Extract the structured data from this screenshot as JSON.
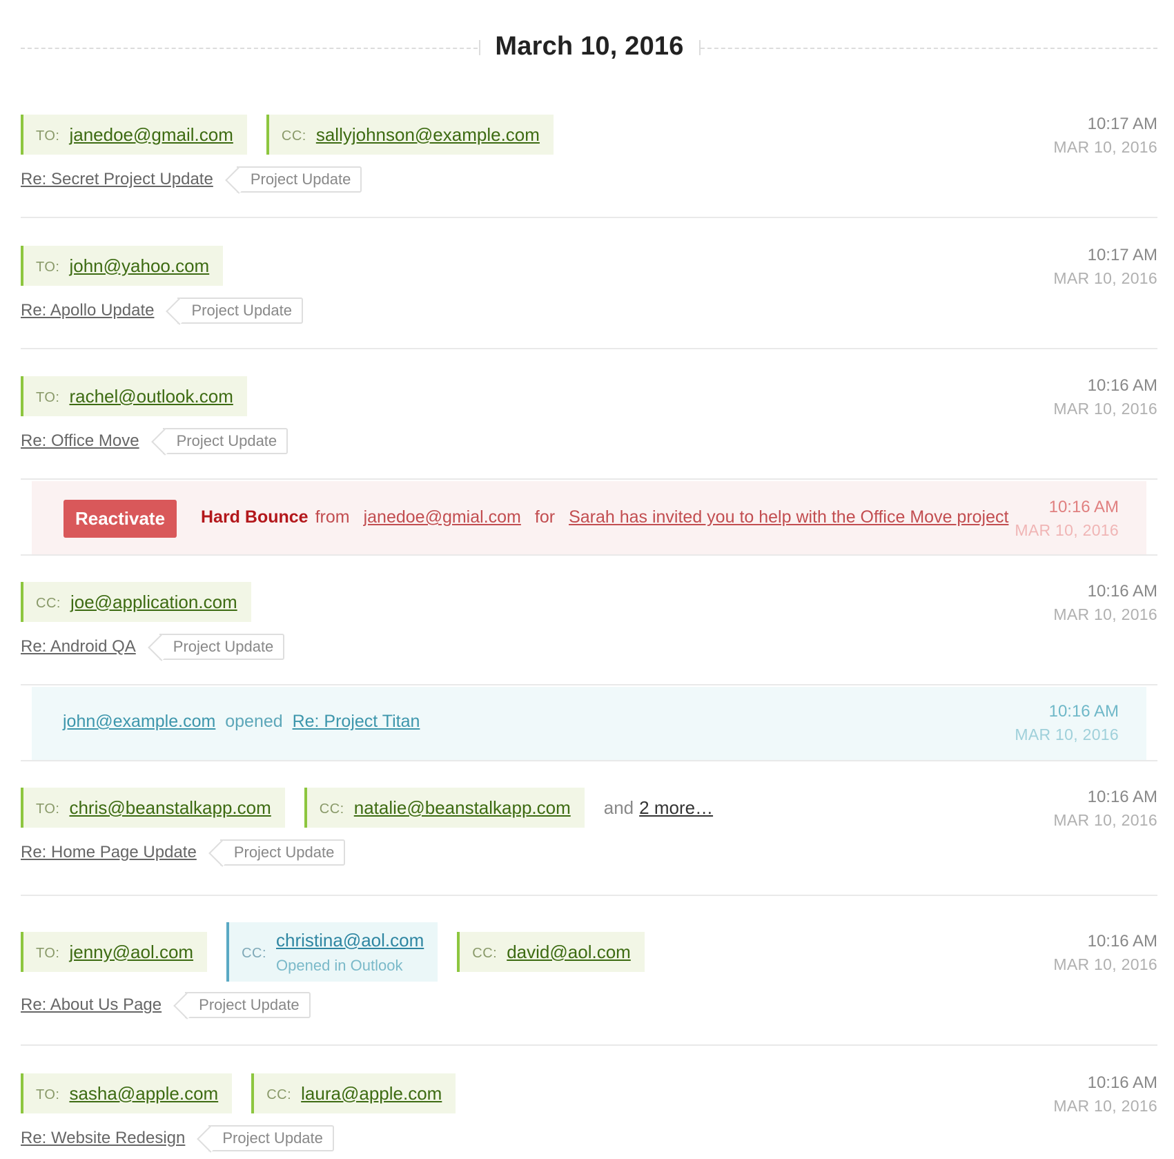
{
  "date_header": "March 10, 2016",
  "rows": [
    {
      "recipients": [
        {
          "label": "TO:",
          "address": "janedoe@gmail.com"
        },
        {
          "label": "CC:",
          "address": "sallyjohnson@example.com"
        }
      ],
      "subject": "Re: Secret Project Update",
      "tag": "Project Update",
      "time": "10:17 AM",
      "date": "MAR 10, 2016"
    },
    {
      "recipients": [
        {
          "label": "TO:",
          "address": "john@yahoo.com"
        }
      ],
      "subject": "Re: Apollo Update",
      "tag": "Project Update",
      "time": "10:17 AM",
      "date": "MAR 10, 2016"
    },
    {
      "recipients": [
        {
          "label": "TO:",
          "address": "rachel@outlook.com"
        }
      ],
      "subject": "Re: Office Move",
      "tag": "Project Update",
      "time": "10:16 AM",
      "date": "MAR 10, 2016"
    },
    {
      "recipients": [
        {
          "label": "CC:",
          "address": "joe@application.com"
        }
      ],
      "subject": "Re: Android QA",
      "tag": "Project Update",
      "time": "10:16 AM",
      "date": "MAR 10, 2016"
    },
    {
      "recipients": [
        {
          "label": "TO:",
          "address": "chris@beanstalkapp.com"
        },
        {
          "label": "CC:",
          "address": "natalie@beanstalkapp.com"
        }
      ],
      "more_prefix": "and",
      "more_link": "2 more…",
      "subject": "Re: Home Page Update",
      "tag": "Project Update",
      "time": "10:16 AM",
      "date": "MAR 10, 2016"
    },
    {
      "recipients": [
        {
          "label": "TO:",
          "address": "jenny@aol.com"
        },
        {
          "label": "CC:",
          "address": "christina@aol.com",
          "status": "Opened in Outlook"
        },
        {
          "label": "CC:",
          "address": "david@aol.com"
        }
      ],
      "subject": "Re: About Us Page",
      "tag": "Project Update",
      "time": "10:16 AM",
      "date": "MAR 10, 2016"
    },
    {
      "recipients": [
        {
          "label": "TO:",
          "address": "sasha@apple.com"
        },
        {
          "label": "CC:",
          "address": "laura@apple.com"
        }
      ],
      "subject": "Re: Website Redesign",
      "tag": "Project Update",
      "time": "10:16 AM",
      "date": "MAR 10, 2016"
    }
  ],
  "bounce": {
    "button": "Reactivate",
    "type": "Hard Bounce",
    "from_word": "from",
    "address": "janedoe@gmial.com",
    "for_word": "for",
    "subject": "Sarah has invited you to help with the Office Move project ",
    "time": "10:16 AM",
    "date": "MAR 10, 2016"
  },
  "opened": {
    "address": "john@example.com",
    "verb": "opened",
    "subject": "Re: Project Titan",
    "time": "10:16 AM",
    "date": "MAR 10, 2016"
  },
  "colors": {
    "recipient_accent": "#8dc63f",
    "opened_accent": "#5aa9c4",
    "bounce_button": "#d9585a"
  }
}
